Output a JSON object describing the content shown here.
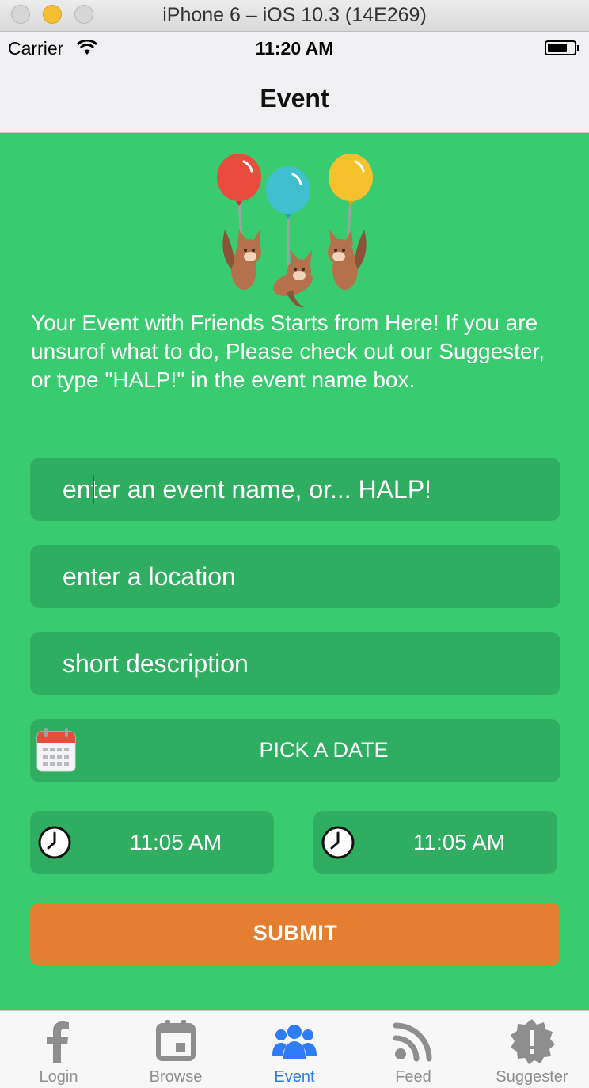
{
  "simulator": {
    "title": "iPhone 6 – iOS 10.3 (14E269)"
  },
  "status_bar": {
    "carrier": "Carrier",
    "time": "11:20 AM"
  },
  "nav": {
    "title": "Event"
  },
  "intro": {
    "text": "Your Event with Friends Starts from Here! If you are unsurof what to do, Please check out our Suggester, or type \"HALP!\" in the event name box."
  },
  "form": {
    "event_name_placeholder": "enter an event name, or... HALP!",
    "location_placeholder": "enter a location",
    "description_placeholder": "short description",
    "date_label": "PICK A DATE",
    "start_time": "11:05 AM",
    "end_time": "11:05 AM",
    "submit_label": "SUBMIT"
  },
  "tabs": [
    {
      "label": "Login",
      "icon": "facebook-icon"
    },
    {
      "label": "Browse",
      "icon": "calendar-icon"
    },
    {
      "label": "Event",
      "icon": "group-icon",
      "active": true
    },
    {
      "label": "Feed",
      "icon": "rss-icon"
    },
    {
      "label": "Suggester",
      "icon": "alert-badge-icon"
    }
  ],
  "colors": {
    "background_green": "#39cb70",
    "field_green": "#2fae62",
    "submit_orange": "#e47f31",
    "tab_active": "#2f7cf6",
    "tab_inactive": "#8e8e8e"
  }
}
